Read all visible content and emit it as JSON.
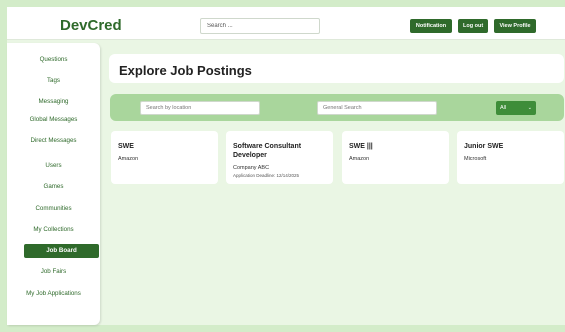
{
  "header": {
    "logo": "DevCred",
    "search_placeholder": "Search ...",
    "buttons": {
      "notification": "Notification",
      "logout": "Log out",
      "view_profile": "View Profile"
    }
  },
  "sidebar": {
    "items": [
      {
        "label": "Questions"
      },
      {
        "label": "Tags"
      },
      {
        "label": "Messaging"
      },
      {
        "label": "Global Messages"
      },
      {
        "label": "Direct Messages"
      },
      {
        "label": "Users"
      },
      {
        "label": "Games"
      },
      {
        "label": "Communities"
      },
      {
        "label": "My Collections"
      },
      {
        "label": "Job Board"
      },
      {
        "label": "Job Fairs"
      },
      {
        "label": "My Job Applications"
      }
    ],
    "active": "Job Board"
  },
  "main": {
    "title": "Explore Job Postings",
    "filters": {
      "location_placeholder": "Search by location",
      "general_placeholder": "General Search",
      "select_value": "All"
    },
    "jobs": [
      {
        "title": "SWE",
        "company": "Amazon",
        "deadline": ""
      },
      {
        "title": "Software Consultant Developer",
        "company": "Company ABC",
        "deadline": "Application Deadline: 12/14/2025"
      },
      {
        "title": "SWE |||",
        "company": "Amazon",
        "deadline": ""
      },
      {
        "title": "Junior SWE",
        "company": "Microsoft",
        "deadline": ""
      }
    ]
  },
  "colors": {
    "accent": "#2f6a2b",
    "background": "#d3ecc9",
    "filter_bar": "#a9d69c"
  }
}
